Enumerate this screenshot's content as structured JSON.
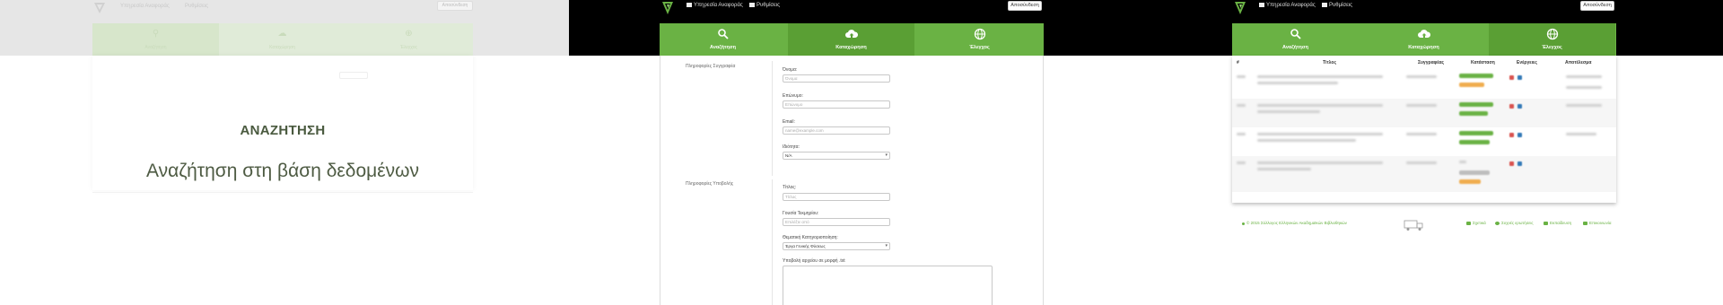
{
  "panel1": {
    "nav": [
      "Υπηρεσία Αναφοράς",
      "Ρυθμίσεις"
    ],
    "logout": "Αποσύνδεση",
    "tabs": [
      "Αναζήτηση",
      "Καταχώρηση",
      "Έλεγχος"
    ],
    "title": "ΑΝΑΖΗΤΗΣΗ",
    "subtitle": "Αναζήτηση στη βάση δεδομένων"
  },
  "panel2": {
    "nav": [
      "Υπηρεσία Αναφοράς",
      "Ρυθμίσεις"
    ],
    "logout": "Αποσύνδεση",
    "tabs": [
      "Αναζήτηση",
      "Καταχώρηση",
      "Έλεγχος"
    ],
    "sections": [
      "Πληροφορίες Συγγραφέα",
      "Πληροφορίες Υποβολής"
    ],
    "fields": {
      "name": {
        "label": "Όνομα:",
        "placeholder": "Όνομα"
      },
      "surname": {
        "label": "Επώνυμο:",
        "placeholder": "Επώνυμο"
      },
      "email": {
        "label": "Email:",
        "placeholder": "name@example.com"
      },
      "role": {
        "label": "Ιδιότητα:",
        "value": "N/A"
      },
      "title": {
        "label": "Τίτλος:",
        "placeholder": "Τίτλος"
      },
      "year": {
        "label": "Γουσία Τεκμηρίου:",
        "placeholder": "Επιλέξτε από"
      },
      "category": {
        "label": "Θεματική Κατηγοριοποίηση:",
        "value": "Έργα Γενικής Φύσεως"
      },
      "upload": {
        "label": "Υποβολή αρχείου σε μορφή .txt"
      }
    }
  },
  "panel3": {
    "nav": [
      "Υπηρεσία Αναφοράς",
      "Ρυθμίσεις"
    ],
    "logout": "Αποσύνδεση",
    "tabs": [
      "Αναζήτηση",
      "Καταχώρηση",
      "Έλεγχος"
    ],
    "columns": [
      "#",
      "Τίτλος",
      "Συγγραφέας",
      "Κατάσταση",
      "Ενέργειες",
      "Αποτέλεσμα"
    ],
    "footer_left": "© 2015 Σύλλογος Ελληνικών Ακαδημαϊκών Βιβλιοθηκών",
    "footer_links": [
      "Σχετικά",
      "Συχνές ερωτήσεις",
      "Εκπαίδευση",
      "Επικοινωνία"
    ]
  },
  "colors": {
    "green": "#6ab244",
    "green_dark": "#5a9f34",
    "black": "#000000"
  }
}
